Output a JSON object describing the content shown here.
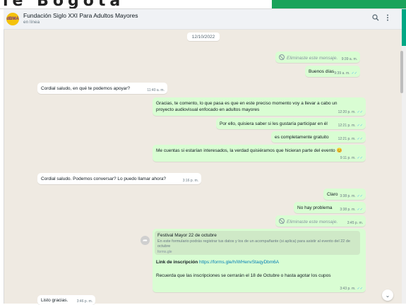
{
  "banner": {
    "text": "le Bogotá"
  },
  "header": {
    "avatar_initials": "dBMA",
    "contact_name": "Fundación Siglo XXI Para Adultos Mayores",
    "status": "en línea",
    "search_icon": "search-icon",
    "menu_icon": "kebab-menu-icon"
  },
  "chat": {
    "date": "12/10/2022",
    "messages": [
      {
        "dir": "out",
        "deleted": true,
        "text": "Eliminaste este mensaje.",
        "time": "9:39 a. m."
      },
      {
        "dir": "out",
        "text": "Buenos días",
        "time": "9:39 a. m.",
        "read": true
      },
      {
        "dir": "in",
        "text": "Cordial saludo, en qué te podemos apoyar?",
        "time": "11:40 a. m."
      },
      {
        "dir": "out",
        "text": "Gracias, te comento, lo que pasa es que en este preciso momento voy a llevar a cabo un proyecto audiovisual enfocado en adultos mayores",
        "time": "12:20 p. m.",
        "read": true
      },
      {
        "dir": "out",
        "text": "Por ello, quisiera saber si les gustaría participar en él",
        "time": "12:21 p. m.",
        "read": true
      },
      {
        "dir": "out",
        "text": "es completamente gratuito",
        "time": "12:21 p. m.",
        "read": true
      },
      {
        "dir": "out",
        "text": "Me cuentas si estarían interesados, la verdad quisiéramos que hicieran parte del evento 😊",
        "time": "9:11 p. m.",
        "read": true
      },
      {
        "dir": "in",
        "text": "Cordial saludo. Podemos conversar? Lo puedo llamar ahora?",
        "time": "3:16 p. m."
      },
      {
        "dir": "out",
        "text": "Claro",
        "time": "3:38 p. m.",
        "read": true
      },
      {
        "dir": "out",
        "text": "No hay problema",
        "time": "3:38 p. m.",
        "read": true
      },
      {
        "dir": "out",
        "deleted": true,
        "text": "Eliminaste este mensaje.",
        "time": "3:45 p. m."
      },
      {
        "dir": "out",
        "preview_title": "Festival Mayor 22 de octubre",
        "preview_desc": "En este formulario podrás registrar tus datos y los de un acompañante (si aplica) para asistir al evento del 22 de octubre",
        "preview_site": "forms.gle",
        "link_label": "Link de inscripción",
        "link_url": "https://forms.gle/h/WHenvStaqyDbm6A",
        "text": "Recuerda que las inscripciones se cerrarán el 18 de Octubre o hasta agotar los cupos",
        "time": "3:43 p. m.",
        "read": true
      },
      {
        "dir": "in",
        "text": "Listo gracias.",
        "time": "3:46 p. m."
      }
    ]
  },
  "icons": {
    "forward": "forward-icon",
    "scroll_down": "chevron-down-icon",
    "tick": "double-check-icon",
    "deleted": "ban-icon"
  },
  "colors": {
    "outgoing": "#d9fdd3",
    "incoming": "#ffffff",
    "background": "#efeae2",
    "header": "#f0f2f5",
    "read_tick": "#53bdeb",
    "accent": "#00a884"
  }
}
